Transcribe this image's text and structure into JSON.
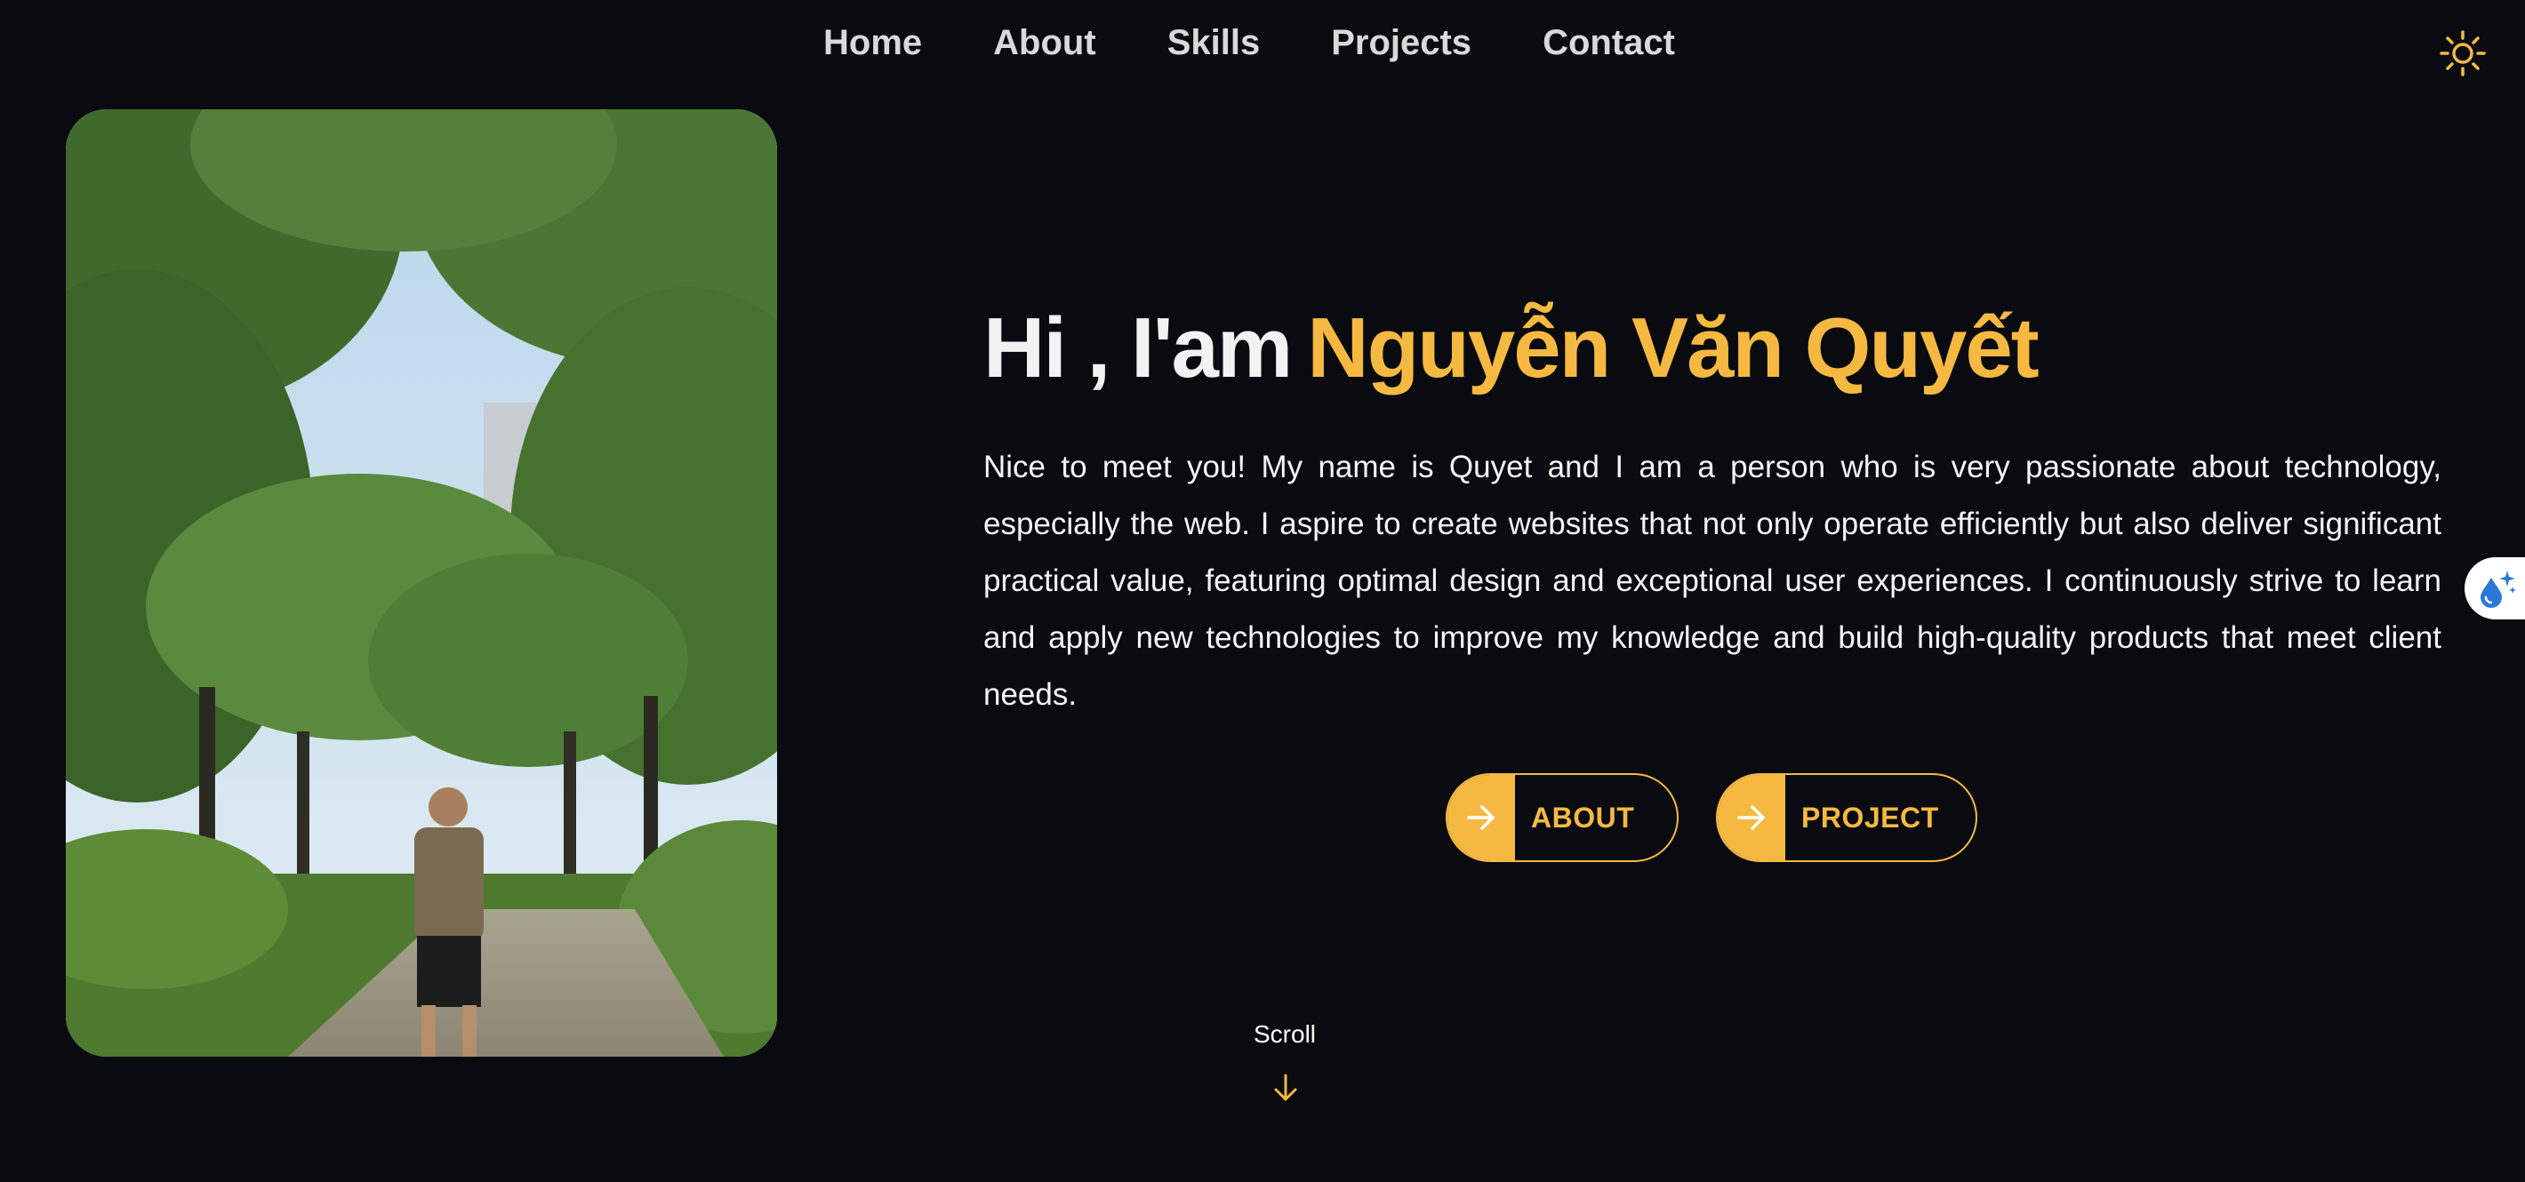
{
  "nav": {
    "items": [
      {
        "label": "Home"
      },
      {
        "label": "About"
      },
      {
        "label": "Skills"
      },
      {
        "label": "Projects"
      },
      {
        "label": "Contact"
      }
    ]
  },
  "theme_toggle": {
    "icon": "sun-icon",
    "color": "#f5b942"
  },
  "hero": {
    "greeting": "Hi , I'am",
    "name": "Nguyễn Văn Quyết",
    "description": "Nice to meet you! My name is Quyet and I am a person who is very passionate about technology, especially the web. I aspire to create websites that not only operate efficiently but also deliver significant practical value, featuring optimal design and exceptional user experiences. I continuously strive to learn and apply new technologies to improve my knowledge and build high-quality products that meet client needs.",
    "photo_icon": "profile-photo"
  },
  "buttons": {
    "about_label": "ABOUT",
    "project_label": "PROJECT"
  },
  "scroll": {
    "label": "Scroll",
    "icon": "arrow-down-icon"
  },
  "side_widget": {
    "icon": "droplet-sparkle-icon"
  },
  "colors": {
    "accent": "#f5b942",
    "background": "#090b10",
    "text": "#ffffff"
  }
}
